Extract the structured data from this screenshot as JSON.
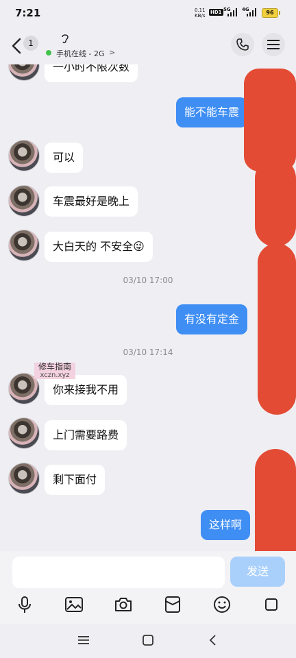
{
  "status": {
    "time": "7:21",
    "net_speed_value": "0.11",
    "net_speed_unit": "KB/s",
    "hd_tag": "HD1",
    "sig1_tag": "5G",
    "sig2_tag": "4G",
    "battery": "96"
  },
  "header": {
    "unread_count": "1",
    "online_status": "手机在线 - 2G",
    "chevron": ">"
  },
  "messages": [
    {
      "side": "them",
      "text": "一小时不限次数"
    },
    {
      "side": "me",
      "text": "能不能车震"
    },
    {
      "side": "them",
      "text": "可以"
    },
    {
      "side": "them",
      "text": "车震最好是晚上"
    },
    {
      "side": "them",
      "text": "大白天的 不安全😜"
    },
    {
      "side": "me",
      "text": "有没有定金"
    },
    {
      "side": "them",
      "text": "你来接我不用"
    },
    {
      "side": "them",
      "text": "上门需要路费"
    },
    {
      "side": "them",
      "text": "剩下面付"
    },
    {
      "side": "me",
      "text": "这样啊"
    }
  ],
  "timestamps": [
    "03/10 17:00",
    "03/10 17:14"
  ],
  "watermark": {
    "line1": "修车指南",
    "line2": "xczn.xyz"
  },
  "composer": {
    "placeholder": "",
    "send_label": "发送"
  },
  "toolbar_icons": [
    "mic-icon",
    "image-icon",
    "camera-icon",
    "red-packet-icon",
    "emoji-icon",
    "more-icon"
  ],
  "colors": {
    "my_bubble": "#3f8ef4",
    "their_bubble": "#ffffff",
    "redaction": "#e34b34",
    "online": "#41c24d",
    "send_disabled": "#a9d0fb"
  }
}
